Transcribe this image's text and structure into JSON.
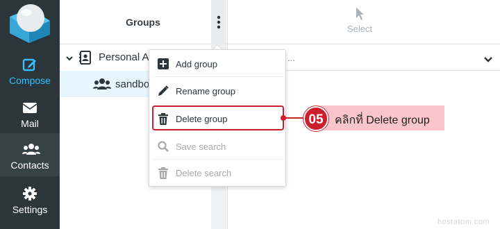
{
  "sidebar": {
    "items": [
      {
        "label": "Compose",
        "icon": "compose-icon"
      },
      {
        "label": "Mail",
        "icon": "mail-icon"
      },
      {
        "label": "Contacts",
        "icon": "contacts-icon"
      },
      {
        "label": "Settings",
        "icon": "gear-icon"
      }
    ],
    "active": "Contacts",
    "accent_color": "#37beff",
    "background": "#2c363a"
  },
  "groups_panel": {
    "title": "Groups",
    "address_book": "Personal A",
    "group": "sandbo"
  },
  "toolbar": {
    "select_label": "Select"
  },
  "list_header": {
    "text": "..."
  },
  "menu": {
    "items": [
      {
        "label": "Add group",
        "icon": "plus-square-icon",
        "enabled": true
      },
      {
        "label": "Rename group",
        "icon": "pencil-icon",
        "enabled": true
      },
      {
        "label": "Delete group",
        "icon": "trash-icon",
        "enabled": true,
        "highlighted": true
      },
      {
        "label": "Save search",
        "icon": "search-icon",
        "enabled": false
      },
      {
        "label": "Delete search",
        "icon": "trash-icon",
        "enabled": false
      }
    ]
  },
  "annotation": {
    "step": "05",
    "text": "คลิกที่ Delete group",
    "color": "#cc1f2b"
  },
  "watermark": "hostatom.com"
}
